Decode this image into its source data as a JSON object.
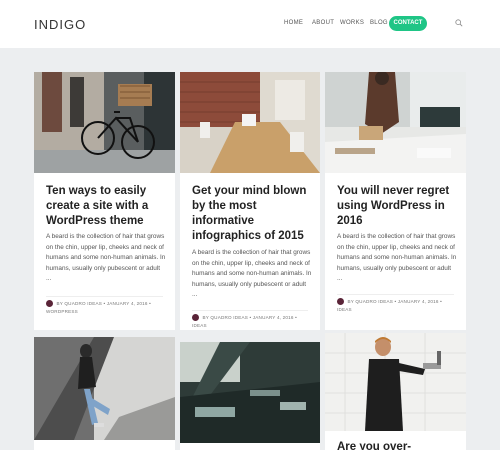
{
  "site": {
    "logo": "INDIGO"
  },
  "nav": {
    "items": [
      "HOME",
      "ABOUT",
      "WORKS",
      "BLOG"
    ],
    "contact": "CONTACT"
  },
  "posts": [
    {
      "title": "Ten ways to easily create a site with a WordPress theme",
      "excerpt": "A beard is the collection of hair that grows on the chin, upper lip, cheeks and neck of humans and some non-human animals. In humans, usually only pubescent or adult ...",
      "author": "BY QUADRO IDEAS",
      "date": "JANUARY 4, 2016",
      "category": "WORDPRESS"
    },
    {
      "title": "Get your mind blown by the most informative infographics of 2015",
      "excerpt": "A beard is the collection of hair that grows on the chin, upper lip, cheeks and neck of humans and some non-human animals. In humans, usually only pubescent or adult ...",
      "author": "BY QUADRO IDEAS",
      "date": "JANUARY 4, 2016",
      "category": "IDEAS"
    },
    {
      "title": "You will never regret using WordPress in 2016",
      "excerpt": "A beard is the collection of hair that grows on the chin, upper lip, cheeks and neck of humans and some non-human animals. In humans, usually only pubescent or adult ...",
      "author": "BY QUADRO IDEAS",
      "date": "JANUARY 4, 2016",
      "category": "IDEAS"
    },
    {
      "title": "Are you over-cleaning"
    }
  ],
  "colors": {
    "accent": "#1fc586",
    "avatar": "#5a2438"
  },
  "icons": {
    "search": "search-icon"
  }
}
